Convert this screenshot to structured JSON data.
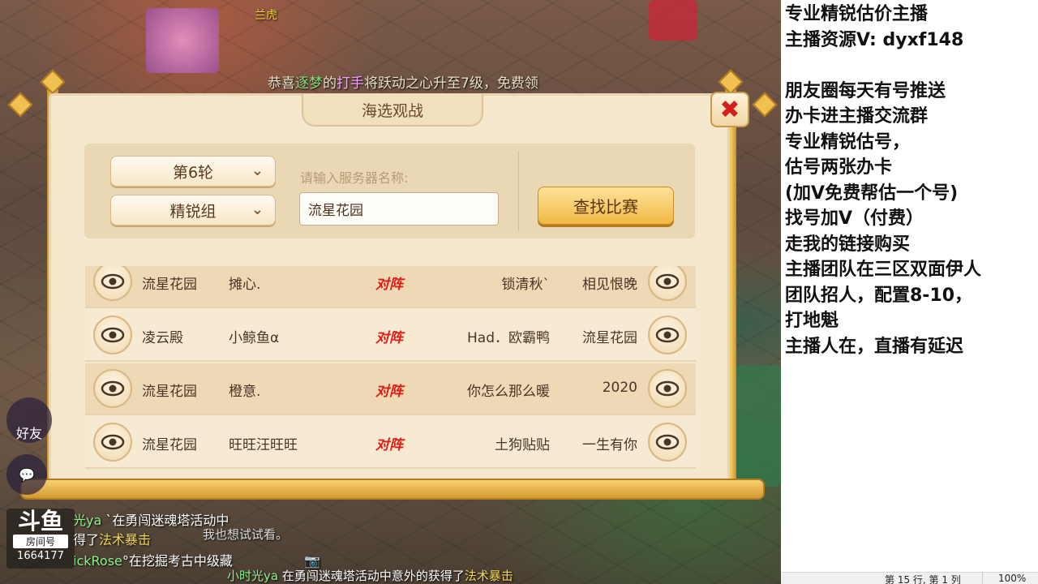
{
  "game": {
    "top_name": "兰虎",
    "broadcast": {
      "prefix": "恭喜",
      "name1": "逐梦",
      "mid": "的",
      "name2": "打手",
      "suffix": "将跃动之心升至7级，免费领"
    },
    "dialog": {
      "title": "海选观战",
      "close_icon": "✖",
      "round_select": "第6轮",
      "group_select": "精锐组",
      "search_label": "请输入服务器名称:",
      "search_value": "流星花园",
      "find_button": "查找比赛",
      "vs_label": "对阵",
      "matches": [
        {
          "server_a": "流星花园",
          "player_a": "摊心.",
          "player_b": "锁清秋`",
          "server_b": "相见恨晚"
        },
        {
          "server_a": "凌云殿",
          "player_a": "小鲸鱼α",
          "player_b": "Had．欧霸鸭",
          "server_b": "流星花园"
        },
        {
          "server_a": "流星花园",
          "player_a": "橙意.",
          "player_b": "你怎么那么暖",
          "server_b": "2020"
        },
        {
          "server_a": "流星花园",
          "player_a": "旺旺汪旺旺",
          "player_b": "土狗贴贴",
          "server_b": "一生有你"
        }
      ]
    },
    "friends_label": "好友",
    "chat": [
      {
        "name": "光ya",
        "text": "`在勇闯迷魂塔活动中"
      },
      {
        "name": "",
        "text": "得了",
        "highlight": "法术暴击"
      },
      {
        "name": "ickRose",
        "text": "°在挖掘考古中级藏"
      },
      {
        "name": "小时光ya",
        "text": "在勇闯迷魂塔活动中意外的获得了",
        "highlight": "法术暴击"
      }
    ],
    "overlay_bubble": "我也想试试看。",
    "logo": {
      "brand": "斗鱼",
      "room_label": "房间号",
      "room_id": "1664177"
    }
  },
  "side_panel": {
    "lines": [
      "专业精锐估价主播",
      "主播资源V: dyxf148",
      "",
      "朋友圈每天有号推送",
      "办卡进主播交流群",
      "专业精锐估号，",
      "估号两张办卡",
      "(加V免费帮估一个号)",
      "找号加V（付费）",
      "走我的链接购买",
      "主播团队在三区双面伊人",
      "团队招人，配置8-10，",
      "打地魁",
      "主播人在，直播有延迟"
    ]
  },
  "status_bar": {
    "position": "第 15 行, 第 1 列",
    "zoom": "100%"
  },
  "colors": {
    "vs_red": "#e01c14",
    "button_gold": "#f0b844",
    "parchment": "#f5e8cf"
  }
}
